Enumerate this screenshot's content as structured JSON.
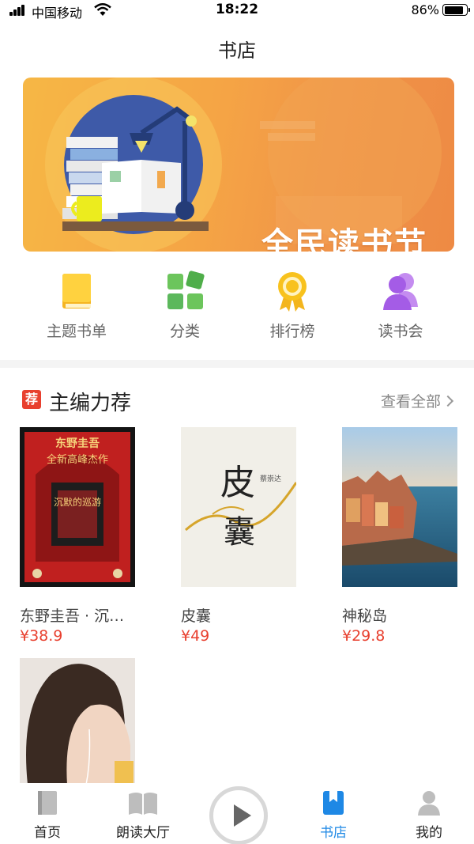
{
  "status_bar": {
    "carrier": "中国移动",
    "time": "18:22",
    "battery_percent": "86%",
    "battery_level": 0.86
  },
  "header": {
    "title": "书店"
  },
  "banner": {
    "title": "全民读书节",
    "slide_count": 1,
    "active_slide": 1
  },
  "quick_entries": [
    {
      "label": "主题书单",
      "icon": "book-icon",
      "color": "#f5b521"
    },
    {
      "label": "分类",
      "icon": "grid-icon",
      "color": "#5cb85c"
    },
    {
      "label": "排行榜",
      "icon": "medal-icon",
      "color": "#f3b51d"
    },
    {
      "label": "读书会",
      "icon": "users-icon",
      "color": "#a45ce6"
    }
  ],
  "section": {
    "badge": "荐",
    "title": "主编力荐",
    "more_label": "查看全部"
  },
  "books": [
    {
      "name": "东野圭吾 · 沉…",
      "price": "¥38.9",
      "cover_lines": [
        "东野圭吾",
        "全新高峰杰作",
        "沉默的巡游"
      ]
    },
    {
      "name": "皮囊",
      "price": "¥49",
      "cover_lines": [
        "皮",
        "囊",
        "蔡崇达"
      ]
    },
    {
      "name": "神秘岛",
      "price": "¥29.8",
      "cover_lines": []
    },
    {
      "name": "",
      "price": "",
      "cover_lines": []
    }
  ],
  "tabbar": {
    "items": [
      {
        "label": "首页",
        "icon": "book-tab-icon"
      },
      {
        "label": "朗读大厅",
        "icon": "open-book-icon"
      },
      {
        "label": "书店",
        "icon": "bookmark-icon",
        "active": true
      },
      {
        "label": "我的",
        "icon": "user-icon"
      }
    ],
    "accent": "#1e88e5"
  }
}
